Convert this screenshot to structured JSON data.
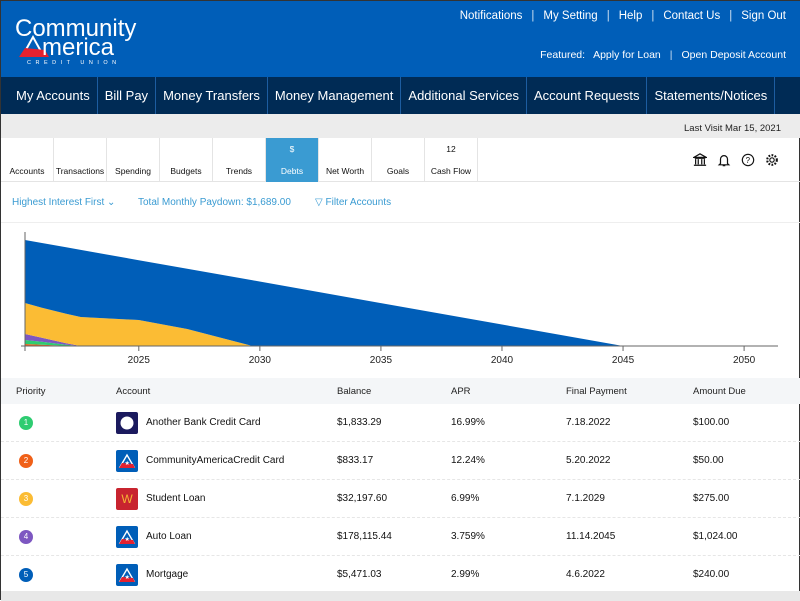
{
  "brand": {
    "name": "CommunityAmerica",
    "tagline": "CREDIT UNION",
    "logo_colors": {
      "text": "#ffffff",
      "flag": "#e4212f"
    }
  },
  "colors": {
    "header": "#005eb8",
    "nav": "#002b55",
    "accent": "#3a9bd2"
  },
  "top_links": [
    "Notifications",
    "My Setting",
    "Help",
    "Contact Us",
    "Sign Out"
  ],
  "featured": {
    "label": "Featured:",
    "links": [
      "Apply for Loan",
      "Open Deposit Account"
    ]
  },
  "nav": [
    "My Accounts",
    "Bill Pay",
    "Money Transfers",
    "Money Management",
    "Additional Services",
    "Account Requests",
    "Statements/Notices"
  ],
  "last_visit": "Last Visit Mar 15, 2021",
  "tools": [
    {
      "label": "Accounts",
      "icon": "bank-icon"
    },
    {
      "label": "Transactions",
      "icon": "list-icon"
    },
    {
      "label": "Spending",
      "icon": "pie-icon"
    },
    {
      "label": "Budgets",
      "icon": "budget-icon"
    },
    {
      "label": "Trends",
      "icon": "clock-icon"
    },
    {
      "label": "Debts",
      "icon": "money-bag-icon",
      "active": true
    },
    {
      "label": "Net Worth",
      "icon": "line-chart-icon"
    },
    {
      "label": "Goals",
      "icon": "navigation-icon"
    },
    {
      "label": "Cash Flow",
      "icon": "calendar-icon",
      "calendar_day": "12"
    }
  ],
  "right_icons": [
    "bank-icon",
    "bell-icon",
    "help-icon",
    "gear-icon"
  ],
  "filters": {
    "sort": "Highest Interest First",
    "paydown": "Total Monthly Paydown: $1,689.00",
    "filter": "Filter Accounts"
  },
  "chart_data": {
    "type": "area",
    "stacked": true,
    "xlim": [
      2020.3,
      2051.4
    ],
    "ylim": [
      0,
      110
    ],
    "x_ticks": [
      2025,
      2030,
      2035,
      2040,
      2045,
      2050
    ],
    "grid": false,
    "y_axis_labels": false,
    "x": [
      2020.3,
      2021,
      2022,
      2022.6,
      2025,
      2027,
      2029.7,
      2035,
      2040,
      2045
    ],
    "series": [
      {
        "color": "#f06018",
        "values": [
          2,
          1.3,
          0.3,
          0,
          0,
          0,
          0,
          0,
          0,
          0
        ]
      },
      {
        "color": "#2ecc71",
        "values": [
          4,
          3,
          1,
          0,
          0,
          0,
          0,
          0,
          0,
          0
        ]
      },
      {
        "color": "#7d57c1",
        "values": [
          6,
          4,
          1.5,
          0,
          0,
          0,
          0,
          0,
          0,
          0
        ]
      },
      {
        "color": "#fbbc34",
        "values": [
          31,
          30,
          29.5,
          29,
          26,
          17,
          0,
          0,
          0,
          0
        ]
      },
      {
        "color": "#005eb8",
        "values": [
          63,
          64.7,
          66.4,
          67.1,
          59.8,
          60.3,
          65.7,
          42.9,
          21.5,
          0
        ]
      }
    ]
  },
  "table": {
    "headers": [
      "Priority",
      "Account",
      "Balance",
      "APR",
      "Final Payment",
      "Amount Due"
    ],
    "rows": [
      {
        "priority": "1",
        "color": "#2ecc71",
        "icon": "other-bank-icon",
        "account": "Another Bank Credit Card",
        "balance": "$1,833.29",
        "apr": "16.99%",
        "final": "7.18.2022",
        "due": "$100.00"
      },
      {
        "priority": "2",
        "color": "#f06018",
        "icon": "communityamerica-icon",
        "account": "CommunityAmericaCredit Card",
        "balance": "$833.17",
        "apr": "12.24%",
        "final": "5.20.2022",
        "due": "$50.00"
      },
      {
        "priority": "3",
        "color": "#fbbc34",
        "icon": "student-loan-icon",
        "icon_letter": "W",
        "account": "Student Loan",
        "balance": "$32,197.60",
        "apr": "6.99%",
        "final": "7.1.2029",
        "due": "$275.00"
      },
      {
        "priority": "4",
        "color": "#7d57c1",
        "icon": "communityamerica-icon",
        "account": "Auto Loan",
        "balance": "$178,115.44",
        "apr": "3.759%",
        "final": "11.14.2045",
        "due": "$1,024.00"
      },
      {
        "priority": "5",
        "color": "#005eb8",
        "icon": "communityamerica-icon",
        "account": "Mortgage",
        "balance": "$5,471.03",
        "apr": "2.99%",
        "final": "4.6.2022",
        "due": "$240.00"
      }
    ]
  }
}
